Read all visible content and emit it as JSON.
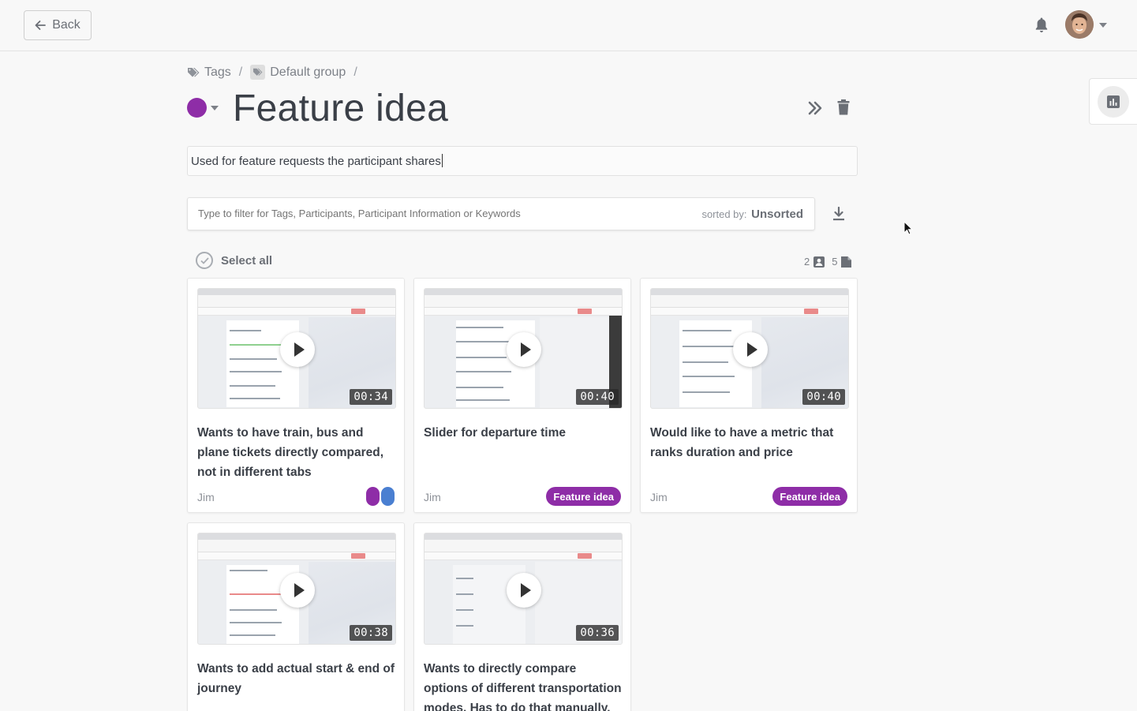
{
  "topbar": {
    "back_label": "Back"
  },
  "breadcrumb": {
    "tags_label": "Tags",
    "group_label": "Default group",
    "separator": "/"
  },
  "tag": {
    "title": "Feature idea",
    "color": "#8e2da7",
    "description": "Used for feature requests the participant shares"
  },
  "filter": {
    "placeholder": "Type to filter for Tags, Participants, Participant Information or Keywords",
    "sorted_prefix": "sorted by:",
    "sorted_value": "Unsorted"
  },
  "selection": {
    "select_all_label": "Select all",
    "participant_count": "2",
    "document_count": "5"
  },
  "cards": [
    {
      "title": "Wants to have train, bus and plane tickets directly compared, not in different tabs",
      "duration": "00:34",
      "author": "Jim",
      "tag": "",
      "tag_colors": [
        "#8e2da7",
        "#4a7fd1"
      ]
    },
    {
      "title": "Slider for departure time",
      "duration": "00:40",
      "author": "Jim",
      "tag": "Feature idea"
    },
    {
      "title": "Would like to have a metric that ranks duration and price",
      "duration": "00:40",
      "author": "Jim",
      "tag": "Feature idea"
    },
    {
      "title": "Wants to add actual start & end of journey",
      "duration": "00:38",
      "author": "",
      "tag": ""
    },
    {
      "title": "Wants to directly compare options of different transportation modes. Has to do that manually.",
      "duration": "00:36",
      "author": "",
      "tag": ""
    }
  ],
  "icons": {
    "back": "arrow-left-icon",
    "bell": "bell-icon",
    "tags": "tags-icon",
    "group": "tag-group-icon",
    "chevrons": "double-chevron-right-icon",
    "trash": "trash-icon",
    "download": "download-icon",
    "stats": "bar-chart-icon",
    "check": "check-circle-icon",
    "person": "person-icon",
    "document": "document-icon",
    "play": "play-icon"
  }
}
